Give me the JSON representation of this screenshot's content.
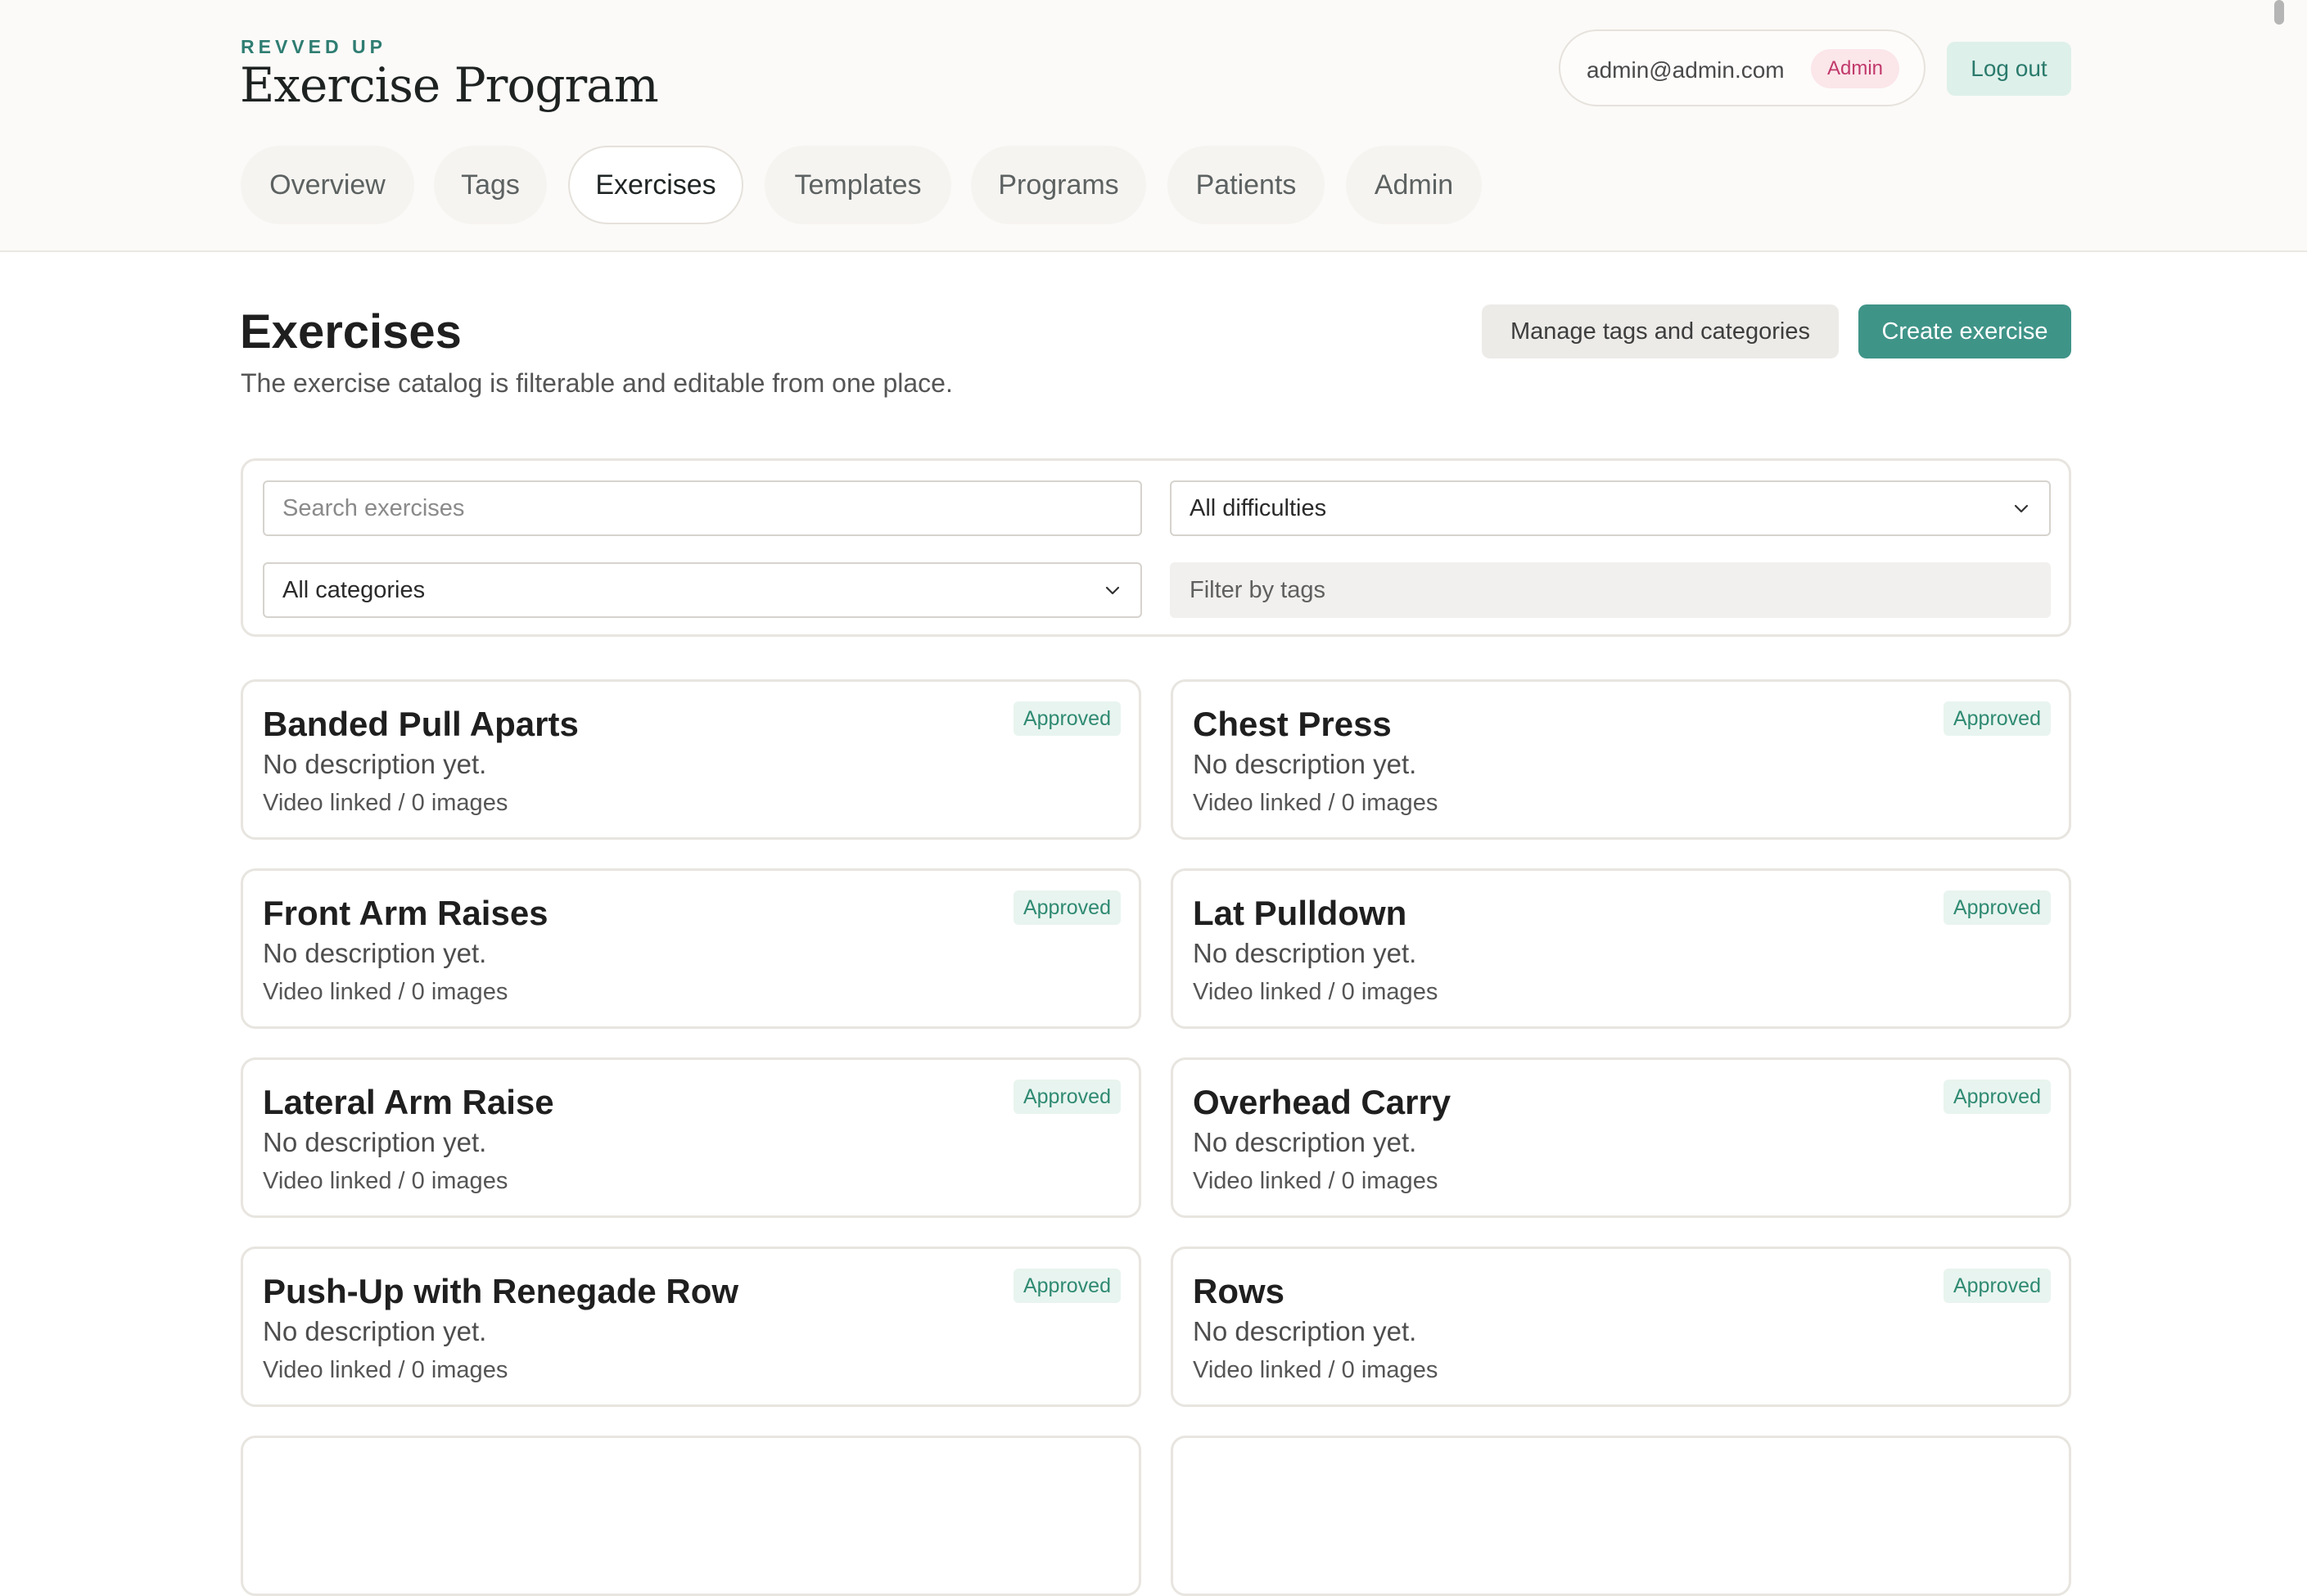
{
  "header": {
    "brand_kicker": "REVVED UP",
    "app_title": "Exercise Program",
    "user_email": "admin@admin.com",
    "role_badge": "Admin",
    "logout_label": "Log out"
  },
  "nav": {
    "tabs": [
      {
        "label": "Overview"
      },
      {
        "label": "Tags"
      },
      {
        "label": "Exercises",
        "active": true
      },
      {
        "label": "Templates"
      },
      {
        "label": "Programs"
      },
      {
        "label": "Patients"
      },
      {
        "label": "Admin"
      }
    ]
  },
  "page": {
    "title": "Exercises",
    "subtitle": "The exercise catalog is filterable and editable from one place.",
    "manage_button": "Manage tags and categories",
    "create_button": "Create exercise"
  },
  "filters": {
    "search_placeholder": "Search exercises",
    "difficulty_value": "All difficulties",
    "category_value": "All categories",
    "tags_placeholder": "Filter by tags"
  },
  "exercises": [
    {
      "name": "Banded Pull Aparts",
      "description": "No description yet.",
      "meta": "Video linked / 0 images",
      "status": "Approved"
    },
    {
      "name": "Chest Press",
      "description": "No description yet.",
      "meta": "Video linked / 0 images",
      "status": "Approved"
    },
    {
      "name": "Front Arm Raises",
      "description": "No description yet.",
      "meta": "Video linked / 0 images",
      "status": "Approved"
    },
    {
      "name": "Lat Pulldown",
      "description": "No description yet.",
      "meta": "Video linked / 0 images",
      "status": "Approved"
    },
    {
      "name": "Lateral Arm Raise",
      "description": "No description yet.",
      "meta": "Video linked / 0 images",
      "status": "Approved"
    },
    {
      "name": "Overhead Carry",
      "description": "No description yet.",
      "meta": "Video linked / 0 images",
      "status": "Approved"
    },
    {
      "name": "Push-Up with Renegade Row",
      "description": "No description yet.",
      "meta": "Video linked / 0 images",
      "status": "Approved"
    },
    {
      "name": "Rows",
      "description": "No description yet.",
      "meta": "Video linked / 0 images",
      "status": "Approved"
    }
  ],
  "colors": {
    "accent": "#3f9488",
    "brand_kicker": "#2f7d72",
    "admin_badge_bg": "#fbe6ea",
    "admin_badge_text": "#c1386a",
    "approved_badge_bg": "#e8f4ef",
    "approved_badge_text": "#2f8a72"
  }
}
